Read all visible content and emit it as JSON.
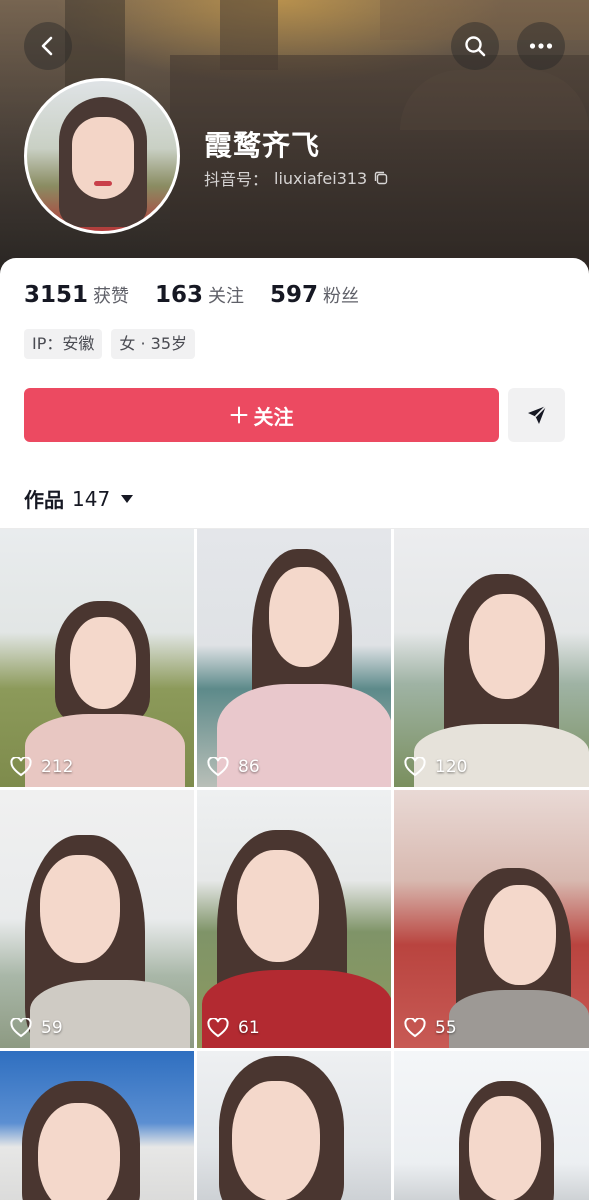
{
  "header": {
    "name": "霞鹜齐飞",
    "id_label": "抖音号：",
    "id_value": "liuxiafei313"
  },
  "stats": [
    {
      "value": "3151",
      "label": "获赞"
    },
    {
      "value": "163",
      "label": "关注"
    },
    {
      "value": "597",
      "label": "粉丝"
    }
  ],
  "tags": [
    "IP：安徽",
    "女 · 35岁"
  ],
  "actions": {
    "follow_label": "关注"
  },
  "works": {
    "label": "作品",
    "count": "147"
  },
  "videos": [
    {
      "likes": "212"
    },
    {
      "likes": "86"
    },
    {
      "likes": "120"
    },
    {
      "likes": "59"
    },
    {
      "likes": "61"
    },
    {
      "likes": "55"
    },
    {
      "likes": ""
    },
    {
      "likes": ""
    },
    {
      "likes": ""
    }
  ],
  "colors": {
    "accent": "#ec4a61",
    "text_primary": "#161823",
    "text_secondary": "#5f6068",
    "tag_bg": "#f1f1f2"
  },
  "icons": [
    "back-arrow-icon",
    "search-icon",
    "more-dots-icon",
    "copy-icon",
    "plus-icon",
    "send-icon",
    "caret-down-icon",
    "heart-icon"
  ]
}
